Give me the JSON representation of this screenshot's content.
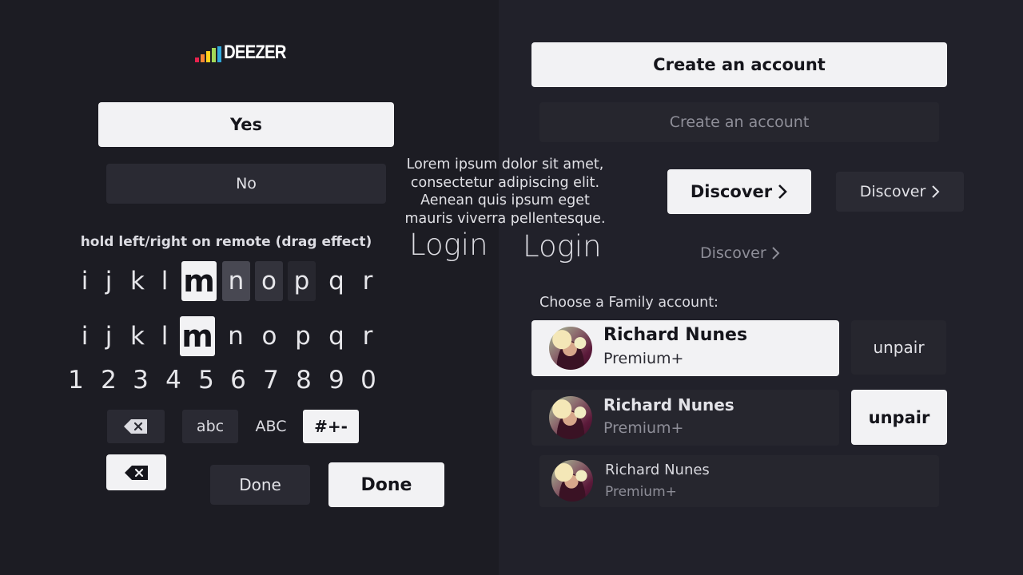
{
  "logo": {
    "text": "DEEZER",
    "bar_colors": [
      "#e7224e",
      "#f58535",
      "#ffd11c",
      "#a2d858",
      "#31a9dc",
      "#c34ea7"
    ]
  },
  "left": {
    "yes_label": "Yes",
    "no_label": "No",
    "hint": "hold left/right on remote (drag effect)",
    "key_row_1": [
      "i",
      "j",
      "k",
      "l",
      "m",
      "n",
      "o",
      "p",
      "q",
      "r"
    ],
    "key_row_2": [
      "i",
      "j",
      "k",
      "l",
      "m",
      "n",
      "o",
      "p",
      "q",
      "r"
    ],
    "number_row": [
      "1",
      "2",
      "3",
      "4",
      "5",
      "6",
      "7",
      "8",
      "9",
      "0"
    ],
    "mode_abc": "abc",
    "mode_ABC": "ABC",
    "mode_symbols": "#+-",
    "done_dark": "Done",
    "done_light": "Done",
    "lorem": "Lorem ipsum dolor sit amet, consectetur adipiscing elit. Aenean quis ipsum eget mauris viverra pellentesque.",
    "login_title_1": "Login"
  },
  "right": {
    "create_light": "Create an account",
    "create_dim": "Create an account",
    "login_title_2": "Login",
    "discover_light": "Discover",
    "discover_dark": "Discover",
    "discover_text": "Discover",
    "family_label": "Choose a Family account:",
    "profiles": [
      {
        "name": "Richard Nunes",
        "plan": "Premium+"
      },
      {
        "name": "Richard Nunes",
        "plan": "Premium+"
      },
      {
        "name": "Richard Nunes",
        "plan": "Premium+"
      }
    ],
    "unpair_dark": "unpair",
    "unpair_light": "unpair"
  }
}
